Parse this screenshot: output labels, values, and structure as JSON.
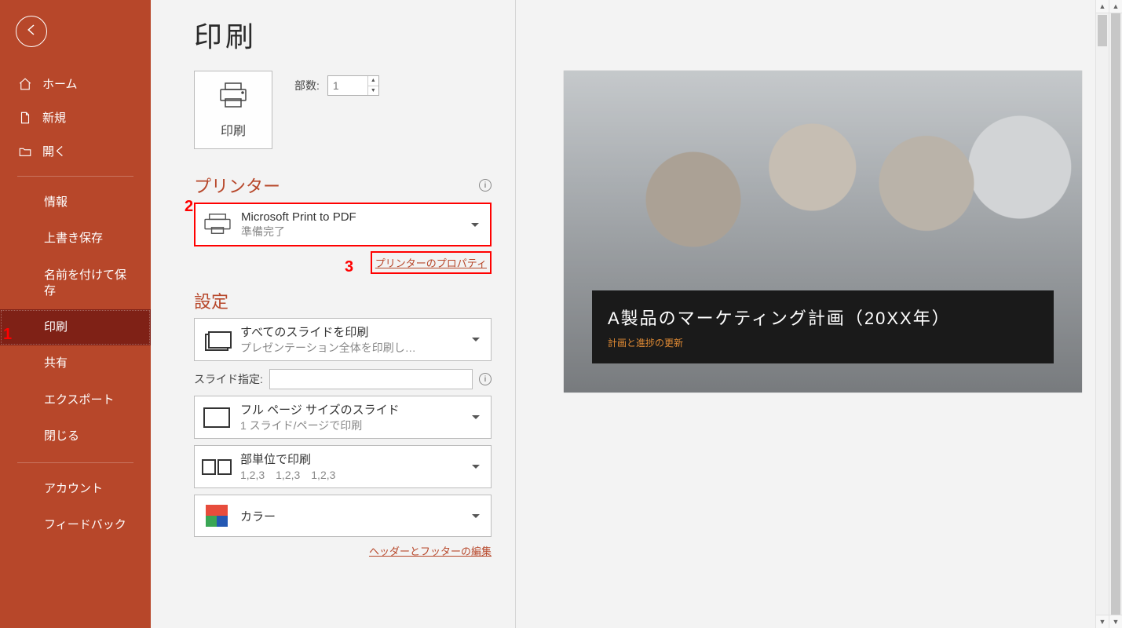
{
  "page_title": "印刷",
  "sidebar": {
    "home": "ホーム",
    "new": "新規",
    "open": "開く",
    "items": [
      "情報",
      "上書き保存",
      "名前を付けて保存",
      "印刷",
      "共有",
      "エクスポート",
      "閉じる"
    ],
    "footer": [
      "アカウント",
      "フィードバック"
    ],
    "active_index": 3
  },
  "print": {
    "print_button_label": "印刷",
    "copies_label": "部数:",
    "copies_value": "1"
  },
  "printer": {
    "section_title": "プリンター",
    "name": "Microsoft Print to PDF",
    "status": "準備完了",
    "properties_link": "プリンターのプロパティ"
  },
  "settings": {
    "section_title": "設定",
    "slides_label": "スライド指定:",
    "slides_value": "",
    "footer_link": "ヘッダーとフッターの編集",
    "options": [
      {
        "line1": "すべてのスライドを印刷",
        "line2": "プレゼンテーション全体を印刷し…"
      },
      {
        "line1": "フル ページ サイズのスライド",
        "line2": "1 スライド/ページで印刷"
      },
      {
        "line1": "部単位で印刷",
        "line2": "1,2,3　1,2,3　1,2,3"
      },
      {
        "line1": "カラー",
        "line2": ""
      }
    ]
  },
  "preview": {
    "slide_title": "A製品のマーケティング計画（20XX年）",
    "slide_subtitle": "計画と進捗の更新"
  },
  "markers": {
    "m1": "1",
    "m2": "2",
    "m3": "3"
  }
}
